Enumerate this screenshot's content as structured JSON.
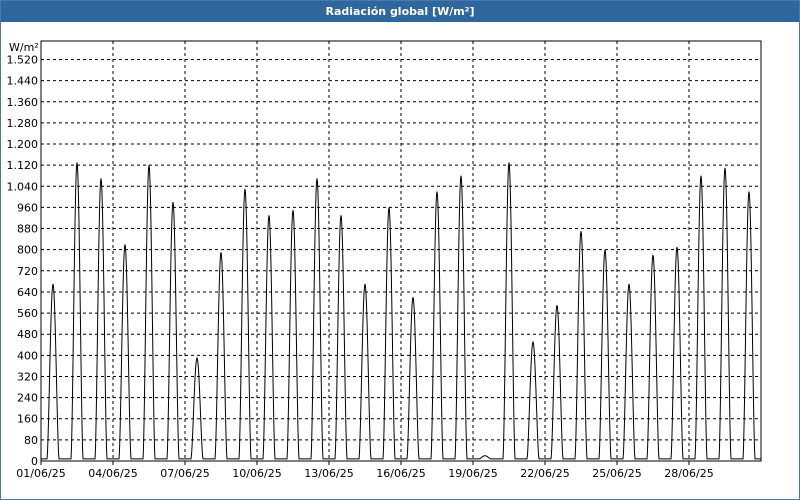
{
  "window": {
    "title": "Radiación global [W/m²]"
  },
  "chart_data": {
    "type": "line",
    "title": "Radiación global [W/m²]",
    "ylabel": "W/m²",
    "xlabel": "",
    "ylim": [
      0,
      1590
    ],
    "xlim": [
      0,
      30
    ],
    "grid": true,
    "y_ticks": [
      "0",
      "80",
      "160",
      "240",
      "320",
      "400",
      "480",
      "560",
      "640",
      "720",
      "800",
      "880",
      "960",
      "1.040",
      "1.120",
      "1.200",
      "1.280",
      "1.360",
      "1.440",
      "1.520"
    ],
    "y_tick_values": [
      0,
      80,
      160,
      240,
      320,
      400,
      480,
      560,
      640,
      720,
      800,
      880,
      960,
      1040,
      1120,
      1200,
      1280,
      1360,
      1440,
      1520
    ],
    "x_ticks": [
      "01/06/25",
      "04/06/25",
      "07/06/25",
      "10/06/25",
      "13/06/25",
      "16/06/25",
      "19/06/25",
      "22/06/25",
      "25/06/25",
      "28/06/25"
    ],
    "x_tick_values": [
      0,
      3,
      6,
      9,
      12,
      15,
      18,
      21,
      24,
      27
    ],
    "series": [
      {
        "name": "",
        "color": "#000000",
        "daily_peak": [
          670,
          1130,
          1070,
          820,
          1120,
          980,
          390,
          790,
          1030,
          930,
          950,
          1070,
          930,
          670,
          960,
          620,
          1020,
          1080,
          20,
          1130,
          450,
          590,
          870,
          800,
          670,
          780,
          810,
          1080,
          1110,
          1020
        ]
      }
    ]
  }
}
